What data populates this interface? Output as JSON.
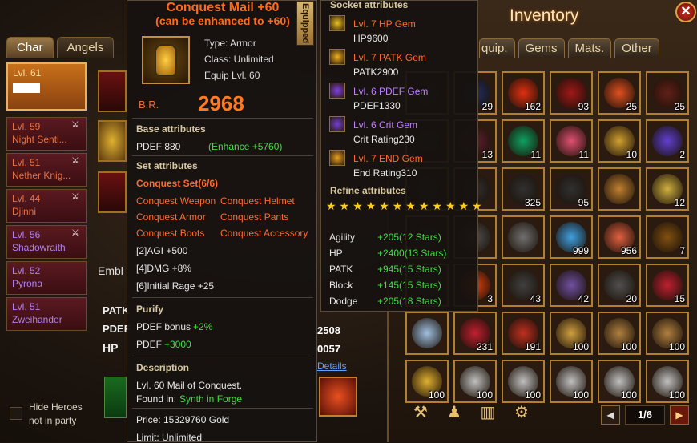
{
  "left": {
    "tabs": [
      "Char",
      "Angels"
    ],
    "heroes": [
      {
        "level": "Lvl. 61",
        "name": "",
        "selected": true,
        "color": "orange"
      },
      {
        "level": "Lvl. 59",
        "name": "Night Senti...",
        "color": "orange"
      },
      {
        "level": "Lvl. 51",
        "name": "Nether Knig...",
        "color": "orange"
      },
      {
        "level": "Lvl. 44",
        "name": "Djinni",
        "color": "orange"
      },
      {
        "level": "Lvl. 56",
        "name": "Shadowraith",
        "color": "purple"
      },
      {
        "level": "Lvl. 52",
        "name": "Pyrona",
        "color": "purple"
      },
      {
        "level": "Lvl. 51",
        "name": "Zweihander",
        "color": "purple"
      }
    ],
    "hide_heroes_line1": "Hide Heroes",
    "hide_heroes_line2": "not in party",
    "emblem_label": "Embl",
    "stat_labels": [
      "PATK",
      "PDEF",
      "HP"
    ],
    "visible_values": [
      "2508",
      "0057"
    ],
    "details_link": "Details"
  },
  "item": {
    "title": "Conquest Mail  +60",
    "subtitle": "(can be enhanced to +60)",
    "equipped_tag": "Equipped",
    "type": "Type: Armor",
    "class": "Class: Unlimited",
    "equip_level": "Equip Lvl. 60",
    "br_label": "B.R.",
    "br_value": "2968",
    "base_header": "Base attributes",
    "base_stat": "PDEF 880",
    "base_enhance": "(Enhance +5760)",
    "set_header": "Set attributes",
    "set_name": "Conquest Set(6/6)",
    "set_items": [
      "Conquest Weapon",
      "Conquest Helmet",
      "Conquest Armor",
      "Conquest Pants",
      "Conquest Boots",
      "Conquest Accessory"
    ],
    "set_bonuses": [
      "[2]AGI +500",
      "[4]DMG +8%",
      "[6]Initial Rage +25"
    ],
    "purify_header": "Purify",
    "purify_1_label": "PDEF bonus",
    "purify_1_value": "+2%",
    "purify_2_label": "PDEF",
    "purify_2_value": "+3000",
    "desc_header": "Description",
    "desc_line": "Lvl. 60 Mail of Conquest.",
    "found_label": "Found in:",
    "found_value": "Synth in Forge",
    "price": "Price: 15329760 Gold",
    "limit": "Limit: Unlimited"
  },
  "sockets": {
    "header": "Socket attributes",
    "gems": [
      {
        "name": "Lvl. 7 HP Gem",
        "value": "HP9600",
        "color": "#ff6a30",
        "icon": "#e8c020"
      },
      {
        "name": "Lvl. 7 PATK Gem",
        "value": "PATK2900",
        "color": "#ff6a30",
        "icon": "#f0b020"
      },
      {
        "name": "Lvl. 6 PDEF Gem",
        "value": "PDEF1330",
        "color": "#c080ff",
        "icon": "#8040e0"
      },
      {
        "name": "Lvl. 6 Crit Gem",
        "value": "Crit Rating230",
        "color": "#c080ff",
        "icon": "#7040d0"
      },
      {
        "name": "Lvl. 7 END Gem",
        "value": "End Rating310",
        "color": "#ff6a30",
        "icon": "#e8a020"
      }
    ],
    "refine_header": "Refine attributes",
    "stars": "★★★★★★★★★★★★",
    "refine": [
      {
        "label": "Agility",
        "value": "+205(12 Stars)"
      },
      {
        "label": "HP",
        "value": "+2400(13 Stars)"
      },
      {
        "label": "PATK",
        "value": "+945(15 Stars)"
      },
      {
        "label": "Block",
        "value": "+145(15 Stars)"
      },
      {
        "label": "Dodge",
        "value": "+205(18 Stars)"
      }
    ]
  },
  "inventory": {
    "title": "Inventory",
    "tabs": [
      "quip.",
      "Gems",
      "Mats.",
      "Other"
    ],
    "page": "1/6",
    "cells": [
      {
        "count": "",
        "color": "#303030"
      },
      {
        "count": "29",
        "color": "#203060"
      },
      {
        "count": "162",
        "color": "#e03010"
      },
      {
        "count": "93",
        "color": "#a01818"
      },
      {
        "count": "25",
        "color": "#e05020"
      },
      {
        "count": "25",
        "color": "#602018"
      },
      {
        "count": "",
        "color": "#303030"
      },
      {
        "count": "13",
        "color": "#602030"
      },
      {
        "count": "11",
        "color": "#10a060"
      },
      {
        "count": "11",
        "color": "#e05070"
      },
      {
        "count": "10",
        "color": "#d0a030"
      },
      {
        "count": "2",
        "color": "#6040d0"
      },
      {
        "count": "",
        "color": "#303030"
      },
      {
        "count": "",
        "color": "#303030"
      },
      {
        "count": "325",
        "color": "#303030"
      },
      {
        "count": "95",
        "color": "#303030"
      },
      {
        "count": "",
        "color": "#c08030"
      },
      {
        "count": "12",
        "color": "#d0b040"
      },
      {
        "count": "",
        "color": "#303030"
      },
      {
        "count": "",
        "color": "#505050"
      },
      {
        "count": "",
        "color": "#707070"
      },
      {
        "count": "999",
        "color": "#40a0e0"
      },
      {
        "count": "956",
        "color": "#e06040"
      },
      {
        "count": "7",
        "color": "#805010"
      },
      {
        "count": "",
        "color": "#303030"
      },
      {
        "count": "3",
        "color": "#e04010"
      },
      {
        "count": "43",
        "color": "#404040"
      },
      {
        "count": "42",
        "color": "#7050a0"
      },
      {
        "count": "20",
        "color": "#505050"
      },
      {
        "count": "15",
        "color": "#c02030"
      },
      {
        "count": "",
        "color": "#a0c0e0"
      },
      {
        "count": "231",
        "color": "#c02030"
      },
      {
        "count": "191",
        "color": "#c03020"
      },
      {
        "count": "100",
        "color": "#d0a040"
      },
      {
        "count": "100",
        "color": "#b08040"
      },
      {
        "count": "100",
        "color": "#b08040"
      },
      {
        "count": "100",
        "color": "#e0b030"
      },
      {
        "count": "100",
        "color": "#c0c0c0"
      },
      {
        "count": "100",
        "color": "#c0c0c0"
      },
      {
        "count": "100",
        "color": "#c0c0c0"
      },
      {
        "count": "100",
        "color": "#c0c0c0"
      },
      {
        "count": "100",
        "color": "#c0c0c0"
      }
    ]
  }
}
